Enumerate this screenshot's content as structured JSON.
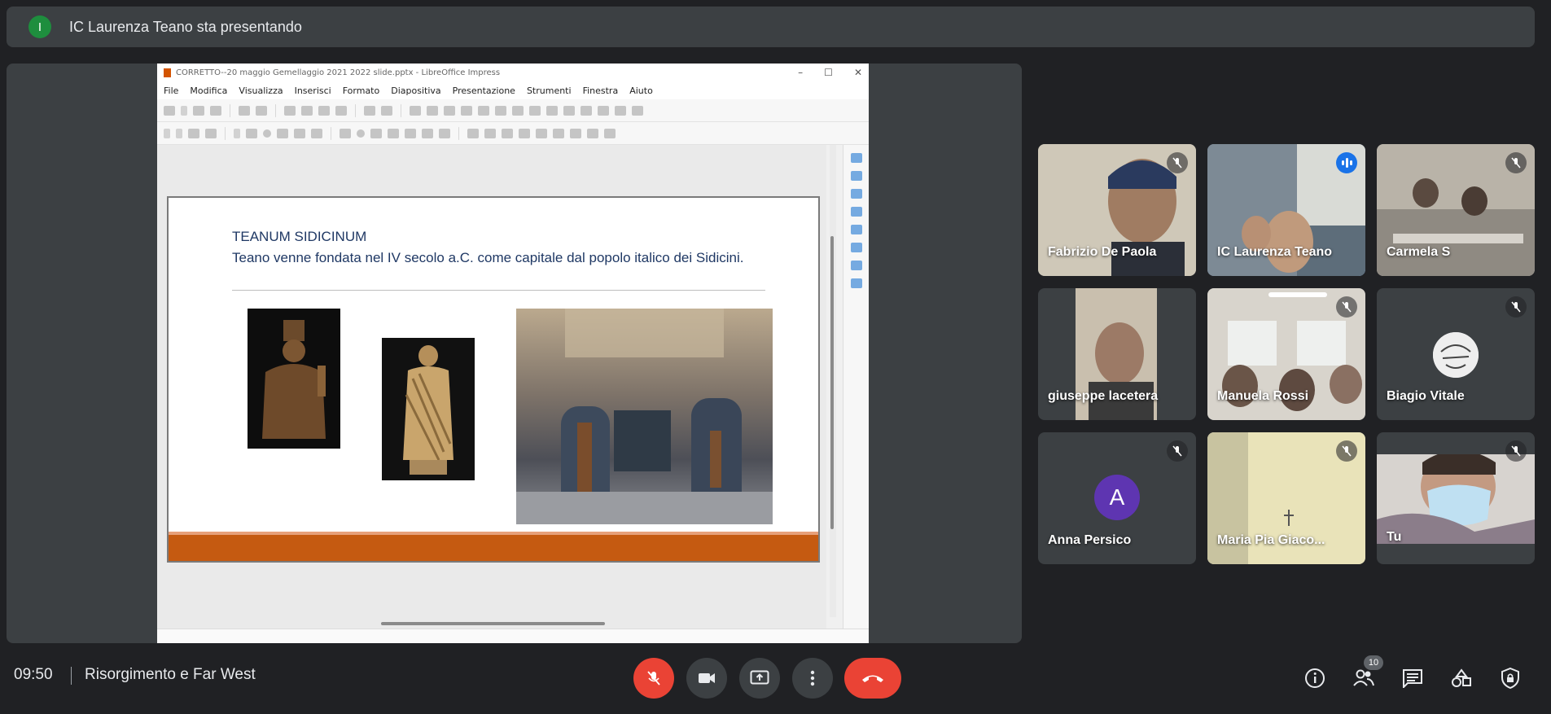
{
  "presenter_banner": {
    "initial": "I",
    "text": "IC Laurenza Teano sta presentando"
  },
  "impress": {
    "window_title": "CORRETTO--20 maggio Gemellaggio 2021 2022 slide.pptx - LibreOffice Impress",
    "menu": [
      "File",
      "Modifica",
      "Visualizza",
      "Inserisci",
      "Formato",
      "Diapositiva",
      "Presentazione",
      "Strumenti",
      "Finestra",
      "Aiuto"
    ],
    "slide": {
      "title": "TEANUM  SIDICINUM",
      "body": "Teano  venne fondata nel IV secolo a.C.  come capitale dal popolo italico dei Sidicini."
    }
  },
  "participants": [
    {
      "name": "Fabrizio De Paola",
      "muted": true
    },
    {
      "name": "IC Laurenza Teano",
      "speaking": true
    },
    {
      "name": "Carmela S",
      "muted": true
    },
    {
      "name": "giuseppe lacetera",
      "muted": false
    },
    {
      "name": "Manuela Rossi",
      "muted": true
    },
    {
      "name": "Biagio Vitale",
      "muted": true
    },
    {
      "name": "Anna Persico",
      "muted": true,
      "initial": "A",
      "avatar_color": "#5e35b1"
    },
    {
      "name": "Maria Pia Giaco...",
      "muted": true
    },
    {
      "name": "Tu",
      "muted": true
    }
  ],
  "bottom_bar": {
    "time": "09:50",
    "meeting_name": "Risorgimento e Far West",
    "participant_count": "10"
  },
  "colors": {
    "end_call": "#ea4335",
    "active_speaker": "#8ab4f8",
    "background": "#202124"
  }
}
